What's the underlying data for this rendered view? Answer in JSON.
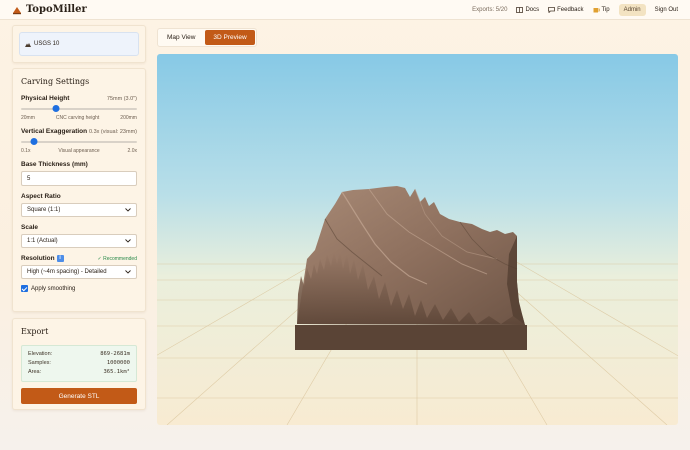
{
  "header": {
    "brand": "TopoMiller",
    "exports": "Exports: 5/20",
    "docs": "Docs",
    "feedback": "Feedback",
    "tip": "Tip",
    "admin": "Admin",
    "signout": "Sign Out"
  },
  "source": {
    "label": "USGS 10"
  },
  "settings": {
    "title": "Carving Settings",
    "physical_height": {
      "label": "Physical Height",
      "value": "75mm (3.0\")",
      "min": "20mm",
      "hint": "CNC carving height",
      "max": "200mm",
      "fraction": 0.3
    },
    "vertical_exaggeration": {
      "label": "Vertical Exaggeration",
      "value": "0.3x (visual: 23mm)",
      "min": "0.1x",
      "hint": "Visual appearance",
      "max": "2.0x",
      "fraction": 0.11
    },
    "base_thickness": {
      "label": "Base Thickness (mm)",
      "value": "5"
    },
    "aspect_ratio": {
      "label": "Aspect Ratio",
      "value": "Square (1:1)"
    },
    "scale": {
      "label": "Scale",
      "value": "1:1 (Actual)"
    },
    "resolution": {
      "label": "Resolution",
      "badge": "✓ Recommended",
      "value": "High (~4m spacing) - Detailed"
    },
    "smoothing": {
      "label": "Apply smoothing",
      "checked": true
    }
  },
  "export": {
    "title": "Export",
    "stats": [
      {
        "label": "Elevation:",
        "value": "869-2681m"
      },
      {
        "label": "Samples:",
        "value": "1000000"
      },
      {
        "label": "Area:",
        "value": "365.1km²"
      }
    ],
    "button": "Generate STL"
  },
  "tabs": [
    {
      "label": "Map View",
      "active": false
    },
    {
      "label": "3D Preview",
      "active": true
    }
  ],
  "colors": {
    "accent": "#c25a17",
    "slider": "#1f6fe0",
    "terrain": "#8a6d5c",
    "base": "#5a4436"
  }
}
